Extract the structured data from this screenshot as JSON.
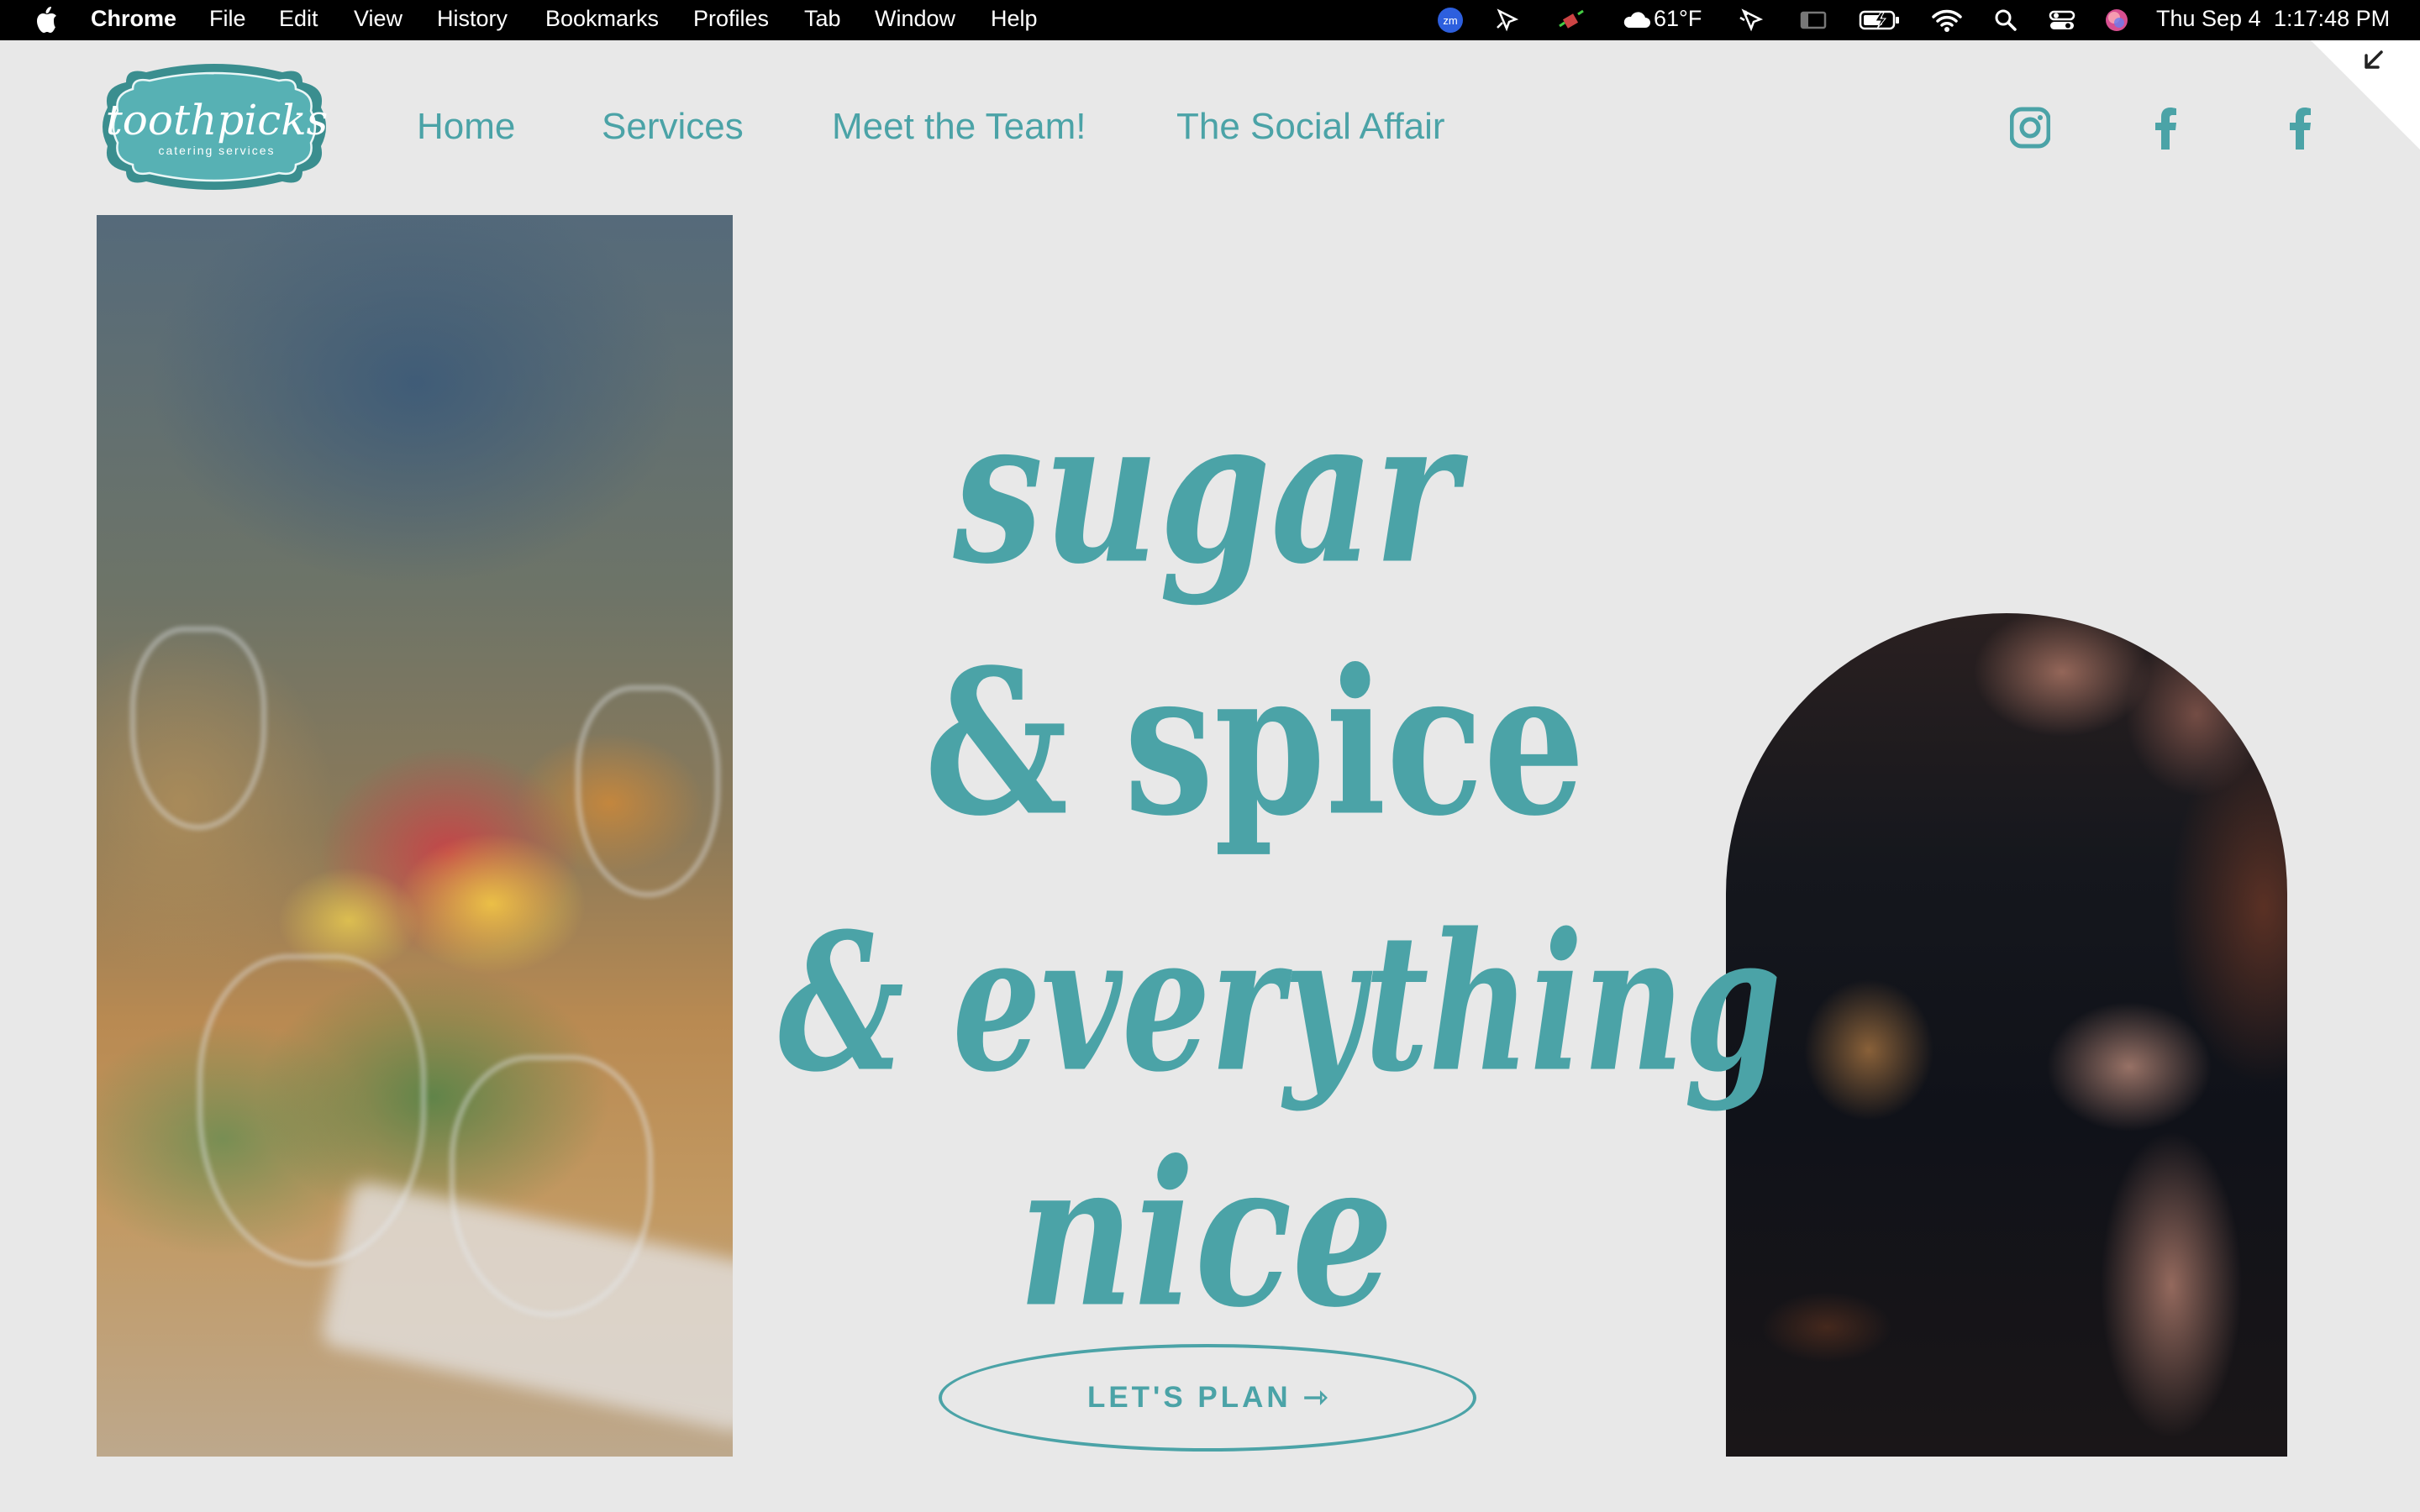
{
  "menubar": {
    "app": "Chrome",
    "menus": [
      "File",
      "Edit",
      "View",
      "History",
      "Bookmarks",
      "Profiles",
      "Tab",
      "Window",
      "Help"
    ],
    "zoom_badge": "zm",
    "weather": "61°F",
    "date": "Thu Sep 4",
    "time": "1:17:48 PM"
  },
  "site": {
    "logo": {
      "name": "toothpicks",
      "tagline": "catering services"
    },
    "nav": [
      "Home",
      "Services",
      "Meet the Team!",
      "The Social Affair"
    ],
    "social_icons": [
      "instagram-icon",
      "facebook-icon",
      "facebook-icon"
    ]
  },
  "hero": {
    "lines": [
      "sugar",
      "& spice",
      "& everything",
      "nice"
    ],
    "cta": {
      "label": "LET'S PLAN",
      "arrow": "⇾"
    }
  },
  "colors": {
    "accent": "#4ba3a7",
    "background": "#e8e8e8",
    "menubar": "#000000"
  }
}
